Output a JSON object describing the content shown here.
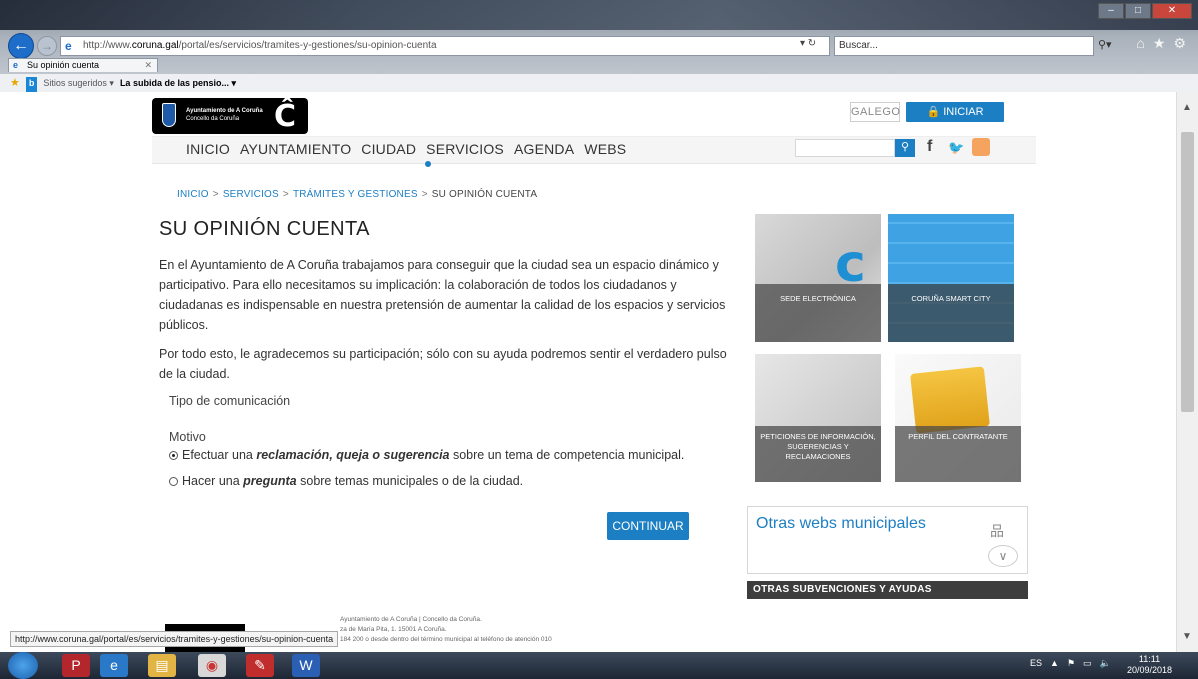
{
  "browser": {
    "url_prefix": "http://www.",
    "url_domain": "coruna.gal",
    "url_path": "/portal/es/servicios/tramites-y-gestiones/su-opinion-cuenta",
    "search_placeholder": "Buscar...",
    "tab_title": "Su opinión cuenta",
    "fav_suggested": "Sitios sugeridos ▾",
    "fav_link": "La subida de las pensio... ▾",
    "status_url": "http://www.coruna.gal/portal/es/servicios/tramites-y-gestiones/su-opinion-cuenta"
  },
  "header": {
    "logo_line1": "Ayuntamiento de A Coruña",
    "logo_line2": "Concello da Coruña",
    "lang_button": "GALEGO",
    "login_button": "INICIAR SESIÓN",
    "nav_items": [
      "INICIO",
      "AYUNTAMIENTO",
      "CIUDAD",
      "SERVICIOS",
      "AGENDA",
      "WEBS"
    ]
  },
  "breadcrumb": {
    "items": [
      "INICIO",
      "SERVICIOS",
      "TRÁMITES Y GESTIONES"
    ],
    "current": "SU OPINIÓN CUENTA",
    "sep": ">"
  },
  "main": {
    "title": "SU OPINIÓN CUENTA",
    "paragraph1": "En el Ayuntamiento de A Coruña trabajamos para conseguir que la ciudad sea un espacio dinámico y participativo. Para ello necesitamos su implicación: la colaboración de todos los ciudadanos y ciudadanas es indispensable en nuestra pretensión de aumentar la calidad de los espacios y servicios públicos.",
    "paragraph2": "Por todo esto, le agradecemos su participación; sólo con su ayuda podremos sentir el verdadero pulso de la ciudad.",
    "tipo_label": "Tipo de comunicación",
    "motivo_label": "Motivo",
    "option1_pre": "Efectuar una ",
    "option1_bold": "reclamación, queja o sugerencia",
    "option1_post": " sobre un tema de competencia municipal.",
    "option2_pre": "Hacer una ",
    "option2_bold": "pregunta",
    "option2_post": " sobre temas municipales o de la ciudad.",
    "continue_button": "CONTINUAR"
  },
  "sidebar": {
    "tiles": [
      "SEDE ELECTRÓNICA",
      "CORUÑA SMART CITY",
      "PETICIONES DE INFORMACIÓN, SUGERENCIAS Y RECLAMACIONES",
      "PERFIL DEL CONTRATANTE"
    ],
    "otras_webs": "Otras webs municipales",
    "subvenciones": "OTRAS SUBVENCIONES Y AYUDAS"
  },
  "footer": {
    "line1": "Ayuntamiento de A Coruña | Concello da Coruña.",
    "line2": "za de María Pita, 1. 15001 A Coruña.",
    "line3": "184 200 o desde dentro del término municipal al teléfono de atención 010"
  },
  "taskbar": {
    "lang": "ES",
    "time": "11:11",
    "date": "20/09/2018"
  },
  "colors": {
    "accent": "#1c7fc3",
    "dark_bar": "#3d3d3d"
  }
}
